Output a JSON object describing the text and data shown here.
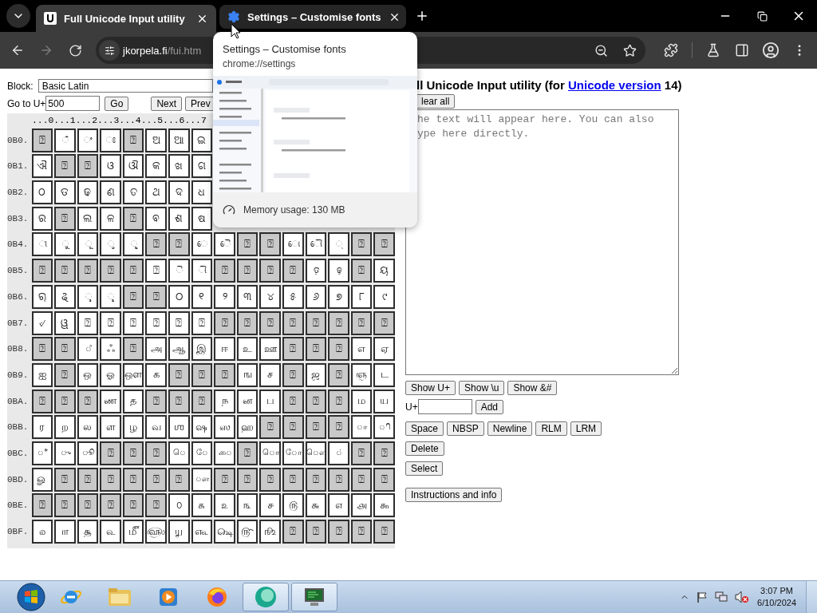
{
  "browser": {
    "tabs": [
      {
        "title": "Full Unicode Input utility",
        "selected": true,
        "kind": "page"
      },
      {
        "title": "Settings – Customise fonts",
        "selected": false,
        "kind": "settings"
      }
    ],
    "address": {
      "host": "jkorpela.fi",
      "path": "/fui.htm"
    }
  },
  "hover_card": {
    "title": "Settings – Customise fonts",
    "url": "chrome://settings",
    "memory": "Memory usage: 130 MB"
  },
  "page": {
    "block": {
      "label": "Block:",
      "value": "Basic Latin"
    },
    "goto": {
      "label": "Go to U+",
      "value": "500"
    },
    "nav_buttons": [
      "Go",
      "Next",
      "Prev"
    ],
    "grid": {
      "column_header": "...0...1...2...3...4...5...6...7",
      "rows": [
        {
          "label": "0B0.",
          "cells": [
            {
              "char": "⍰",
              "assigned": false
            },
            {
              "char": "◌ଁ",
              "assigned": true
            },
            {
              "char": "◌ଂ",
              "assigned": true
            },
            {
              "char": "◌ଃ",
              "assigned": true
            },
            {
              "char": "⍰",
              "assigned": false
            },
            {
              "char": "ଅ",
              "assigned": true
            },
            {
              "char": "ଆ",
              "assigned": true
            },
            {
              "char": "ଇ",
              "assigned": true
            }
          ]
        },
        {
          "label": "0B1.",
          "cells": [
            {
              "char": "ଐ",
              "assigned": true
            },
            {
              "char": "⍰",
              "assigned": false
            },
            {
              "char": "⍰",
              "assigned": false
            },
            {
              "char": "ଓ",
              "assigned": true
            },
            {
              "char": "ଔ",
              "assigned": true
            },
            {
              "char": "କ",
              "assigned": true
            },
            {
              "char": "ଖ",
              "assigned": true
            },
            {
              "char": "ଗ",
              "assigned": true
            }
          ]
        },
        {
          "label": "0B2.",
          "cells": [
            {
              "char": "ଠ",
              "assigned": true
            },
            {
              "char": "ଡ",
              "assigned": true
            },
            {
              "char": "ଢ",
              "assigned": true
            },
            {
              "char": "ଣ",
              "assigned": true
            },
            {
              "char": "ତ",
              "assigned": true
            },
            {
              "char": "ଥ",
              "assigned": true
            },
            {
              "char": "ଦ",
              "assigned": true
            },
            {
              "char": "ଧ",
              "assigned": true
            }
          ]
        },
        {
          "label": "0B3.",
          "cells": [
            {
              "char": "ର",
              "assigned": true
            },
            {
              "char": "⍰",
              "assigned": false
            },
            {
              "char": "ଲ",
              "assigned": true
            },
            {
              "char": "ଳ",
              "assigned": true
            },
            {
              "char": "⍰",
              "assigned": false
            },
            {
              "char": "ଵ",
              "assigned": true
            },
            {
              "char": "ଶ",
              "assigned": true
            },
            {
              "char": "ଷ",
              "assigned": true
            }
          ]
        },
        {
          "label": "0B4.",
          "cells": [
            {
              "char": "◌ୀ",
              "assigned": true
            },
            {
              "char": "◌ୁ",
              "assigned": true
            },
            {
              "char": "◌ୂ",
              "assigned": true
            },
            {
              "char": "◌ୃ",
              "assigned": true
            },
            {
              "char": "◌ୄ",
              "assigned": true
            },
            {
              "char": "⍰",
              "assigned": false
            },
            {
              "char": "⍰",
              "assigned": false
            },
            {
              "char": "◌େ",
              "assigned": true
            },
            {
              "char": "◌ୈ",
              "assigned": true
            },
            {
              "char": "⍰",
              "assigned": false
            },
            {
              "char": "⍰",
              "assigned": false
            },
            {
              "char": "◌ୋ",
              "assigned": true
            },
            {
              "char": "◌ୌ",
              "assigned": true
            },
            {
              "char": "◌୍",
              "assigned": true
            },
            {
              "char": "⍰",
              "assigned": false
            },
            {
              "char": "⍰",
              "assigned": false
            }
          ]
        },
        {
          "label": "0B5.",
          "cells": [
            {
              "char": "⍰",
              "assigned": false
            },
            {
              "char": "⍰",
              "assigned": false
            },
            {
              "char": "⍰",
              "assigned": false
            },
            {
              "char": "⍰",
              "assigned": false
            },
            {
              "char": "⍰",
              "assigned": false
            },
            {
              "char": "⍰",
              "assigned": true
            },
            {
              "char": "◌ୖ",
              "assigned": true
            },
            {
              "char": "◌ୗ",
              "assigned": true
            },
            {
              "char": "⍰",
              "assigned": false
            },
            {
              "char": "⍰",
              "assigned": false
            },
            {
              "char": "⍰",
              "assigned": false
            },
            {
              "char": "⍰",
              "assigned": false
            },
            {
              "char": "ଡ଼",
              "assigned": true
            },
            {
              "char": "ଢ଼",
              "assigned": true
            },
            {
              "char": "⍰",
              "assigned": false
            },
            {
              "char": "ୟ",
              "assigned": true
            }
          ]
        },
        {
          "label": "0B6.",
          "cells": [
            {
              "char": "ୠ",
              "assigned": true
            },
            {
              "char": "ୡ",
              "assigned": true
            },
            {
              "char": "◌ୢ",
              "assigned": true
            },
            {
              "char": "◌ୣ",
              "assigned": true
            },
            {
              "char": "⍰",
              "assigned": false
            },
            {
              "char": "⍰",
              "assigned": false
            },
            {
              "char": "୦",
              "assigned": true
            },
            {
              "char": "୧",
              "assigned": true
            },
            {
              "char": "୨",
              "assigned": true
            },
            {
              "char": "୩",
              "assigned": true
            },
            {
              "char": "୪",
              "assigned": true
            },
            {
              "char": "୫",
              "assigned": true
            },
            {
              "char": "୬",
              "assigned": true
            },
            {
              "char": "୭",
              "assigned": true
            },
            {
              "char": "୮",
              "assigned": true
            },
            {
              "char": "୯",
              "assigned": true
            }
          ]
        },
        {
          "label": "0B7.",
          "cells": [
            {
              "char": "୰",
              "assigned": true
            },
            {
              "char": "ୱ",
              "assigned": true
            },
            {
              "char": "⍰",
              "assigned": true
            },
            {
              "char": "⍰",
              "assigned": true
            },
            {
              "char": "⍰",
              "assigned": true
            },
            {
              "char": "⍰",
              "assigned": true
            },
            {
              "char": "⍰",
              "assigned": true
            },
            {
              "char": "⍰",
              "assigned": true
            },
            {
              "char": "⍰",
              "assigned": false
            },
            {
              "char": "⍰",
              "assigned": false
            },
            {
              "char": "⍰",
              "assigned": false
            },
            {
              "char": "⍰",
              "assigned": false
            },
            {
              "char": "⍰",
              "assigned": false
            },
            {
              "char": "⍰",
              "assigned": false
            },
            {
              "char": "⍰",
              "assigned": false
            },
            {
              "char": "⍰",
              "assigned": false
            }
          ]
        },
        {
          "label": "0B8.",
          "cells": [
            {
              "char": "⍰",
              "assigned": false
            },
            {
              "char": "⍰",
              "assigned": false
            },
            {
              "char": "◌ஂ",
              "assigned": true
            },
            {
              "char": "ஃ",
              "assigned": true
            },
            {
              "char": "⍰",
              "assigned": false
            },
            {
              "char": "அ",
              "assigned": true
            },
            {
              "char": "ஆ",
              "assigned": true
            },
            {
              "char": "இ",
              "assigned": true
            },
            {
              "char": "ஈ",
              "assigned": true
            },
            {
              "char": "உ",
              "assigned": true
            },
            {
              "char": "ஊ",
              "assigned": true
            },
            {
              "char": "⍰",
              "assigned": false
            },
            {
              "char": "⍰",
              "assigned": false
            },
            {
              "char": "⍰",
              "assigned": false
            },
            {
              "char": "எ",
              "assigned": true
            },
            {
              "char": "ஏ",
              "assigned": true
            }
          ]
        },
        {
          "label": "0B9.",
          "cells": [
            {
              "char": "ஐ",
              "assigned": true
            },
            {
              "char": "⍰",
              "assigned": false
            },
            {
              "char": "ஒ",
              "assigned": true
            },
            {
              "char": "ஓ",
              "assigned": true
            },
            {
              "char": "ஔ",
              "assigned": true
            },
            {
              "char": "க",
              "assigned": true
            },
            {
              "char": "⍰",
              "assigned": false
            },
            {
              "char": "⍰",
              "assigned": false
            },
            {
              "char": "⍰",
              "assigned": false
            },
            {
              "char": "ங",
              "assigned": true
            },
            {
              "char": "ச",
              "assigned": true
            },
            {
              "char": "⍰",
              "assigned": false
            },
            {
              "char": "ஜ",
              "assigned": true
            },
            {
              "char": "⍰",
              "assigned": false
            },
            {
              "char": "ஞ",
              "assigned": true
            },
            {
              "char": "ட",
              "assigned": true
            }
          ]
        },
        {
          "label": "0BA.",
          "cells": [
            {
              "char": "⍰",
              "assigned": false
            },
            {
              "char": "⍰",
              "assigned": false
            },
            {
              "char": "⍰",
              "assigned": false
            },
            {
              "char": "ண",
              "assigned": true
            },
            {
              "char": "த",
              "assigned": true
            },
            {
              "char": "⍰",
              "assigned": false
            },
            {
              "char": "⍰",
              "assigned": false
            },
            {
              "char": "⍰",
              "assigned": false
            },
            {
              "char": "ந",
              "assigned": true
            },
            {
              "char": "ன",
              "assigned": true
            },
            {
              "char": "ப",
              "assigned": true
            },
            {
              "char": "⍰",
              "assigned": false
            },
            {
              "char": "⍰",
              "assigned": false
            },
            {
              "char": "⍰",
              "assigned": false
            },
            {
              "char": "ம",
              "assigned": true
            },
            {
              "char": "ய",
              "assigned": true
            }
          ]
        },
        {
          "label": "0BB.",
          "cells": [
            {
              "char": "ர",
              "assigned": true
            },
            {
              "char": "ற",
              "assigned": true
            },
            {
              "char": "ல",
              "assigned": true
            },
            {
              "char": "ள",
              "assigned": true
            },
            {
              "char": "ழ",
              "assigned": true
            },
            {
              "char": "வ",
              "assigned": true
            },
            {
              "char": "ஶ",
              "assigned": true
            },
            {
              "char": "ஷ",
              "assigned": true
            },
            {
              "char": "ஸ",
              "assigned": true
            },
            {
              "char": "ஹ",
              "assigned": true
            },
            {
              "char": "⍰",
              "assigned": false
            },
            {
              "char": "⍰",
              "assigned": false
            },
            {
              "char": "⍰",
              "assigned": false
            },
            {
              "char": "⍰",
              "assigned": false
            },
            {
              "char": "◌ா",
              "assigned": true
            },
            {
              "char": "◌ி",
              "assigned": true
            }
          ]
        },
        {
          "label": "0BC.",
          "cells": [
            {
              "char": "◌ீ",
              "assigned": true
            },
            {
              "char": "◌ு",
              "assigned": true
            },
            {
              "char": "◌ூ",
              "assigned": true
            },
            {
              "char": "⍰",
              "assigned": false
            },
            {
              "char": "⍰",
              "assigned": false
            },
            {
              "char": "⍰",
              "assigned": false
            },
            {
              "char": "◌ெ",
              "assigned": true
            },
            {
              "char": "◌ே",
              "assigned": true
            },
            {
              "char": "◌ை",
              "assigned": true
            },
            {
              "char": "⍰",
              "assigned": false
            },
            {
              "char": "◌ொ",
              "assigned": true
            },
            {
              "char": "◌ோ",
              "assigned": true
            },
            {
              "char": "◌ௌ",
              "assigned": true
            },
            {
              "char": "◌்",
              "assigned": true
            },
            {
              "char": "⍰",
              "assigned": false
            },
            {
              "char": "⍰",
              "assigned": false
            }
          ]
        },
        {
          "label": "0BD.",
          "cells": [
            {
              "char": "ௐ",
              "assigned": true
            },
            {
              "char": "⍰",
              "assigned": false
            },
            {
              "char": "⍰",
              "assigned": false
            },
            {
              "char": "⍰",
              "assigned": false
            },
            {
              "char": "⍰",
              "assigned": false
            },
            {
              "char": "⍰",
              "assigned": false
            },
            {
              "char": "⍰",
              "assigned": false
            },
            {
              "char": "◌ௗ",
              "assigned": true
            },
            {
              "char": "⍰",
              "assigned": false
            },
            {
              "char": "⍰",
              "assigned": false
            },
            {
              "char": "⍰",
              "assigned": false
            },
            {
              "char": "⍰",
              "assigned": false
            },
            {
              "char": "⍰",
              "assigned": false
            },
            {
              "char": "⍰",
              "assigned": false
            },
            {
              "char": "⍰",
              "assigned": false
            },
            {
              "char": "⍰",
              "assigned": false
            }
          ]
        },
        {
          "label": "0BE.",
          "cells": [
            {
              "char": "⍰",
              "assigned": false
            },
            {
              "char": "⍰",
              "assigned": false
            },
            {
              "char": "⍰",
              "assigned": false
            },
            {
              "char": "⍰",
              "assigned": false
            },
            {
              "char": "⍰",
              "assigned": false
            },
            {
              "char": "⍰",
              "assigned": false
            },
            {
              "char": "௦",
              "assigned": true
            },
            {
              "char": "௧",
              "assigned": true
            },
            {
              "char": "௨",
              "assigned": true
            },
            {
              "char": "௩",
              "assigned": true
            },
            {
              "char": "௪",
              "assigned": true
            },
            {
              "char": "௫",
              "assigned": true
            },
            {
              "char": "௬",
              "assigned": true
            },
            {
              "char": "௭",
              "assigned": true
            },
            {
              "char": "௮",
              "assigned": true
            },
            {
              "char": "௯",
              "assigned": true
            }
          ]
        },
        {
          "label": "0BF.",
          "cells": [
            {
              "char": "௰",
              "assigned": true
            },
            {
              "char": "௱",
              "assigned": true
            },
            {
              "char": "௲",
              "assigned": true
            },
            {
              "char": "௳",
              "assigned": true
            },
            {
              "char": "௴",
              "assigned": true
            },
            {
              "char": "௵",
              "assigned": true
            },
            {
              "char": "௶",
              "assigned": true
            },
            {
              "char": "௷",
              "assigned": true
            },
            {
              "char": "௸",
              "assigned": true
            },
            {
              "char": "௹",
              "assigned": true
            },
            {
              "char": "௺",
              "assigned": true
            },
            {
              "char": "⍰",
              "assigned": false
            },
            {
              "char": "⍰",
              "assigned": false
            },
            {
              "char": "⍰",
              "assigned": false
            },
            {
              "char": "⍰",
              "assigned": false
            },
            {
              "char": "⍰",
              "assigned": false
            }
          ]
        }
      ]
    }
  },
  "editor": {
    "heading": {
      "before": "ll Unicode Input utility (for ",
      "link": "Unicode version",
      "after": " 14)"
    },
    "clear_button": "lear all",
    "placeholder": "he text will appear here. You can also\nype here directly.",
    "show_buttons": [
      "Show U+",
      "Show \\u",
      "Show &#"
    ],
    "add": {
      "label": "U+",
      "button": "Add"
    },
    "char_buttons": [
      "Space",
      "NBSP",
      "Newline",
      "RLM",
      "LRM"
    ],
    "delete_button": "Delete",
    "select_button": "Select",
    "info_button": "Instructions and info"
  },
  "taskbar": {
    "apps": [
      {
        "kind": "ebrowser",
        "running": false
      },
      {
        "kind": "folder",
        "running": false
      },
      {
        "kind": "player",
        "running": false
      },
      {
        "kind": "orangeglobe",
        "running": false
      },
      {
        "kind": "tealcircle",
        "running": true
      },
      {
        "kind": "monitor",
        "running": true
      }
    ],
    "time": "3:07 PM",
    "date": "6/10/2024"
  }
}
